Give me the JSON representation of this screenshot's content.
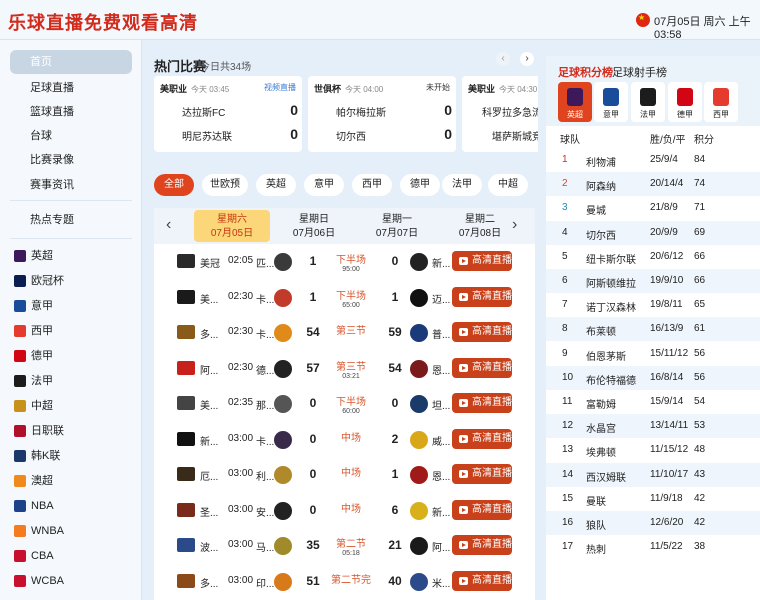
{
  "header": {
    "logo": "乐球直播免费观看高清",
    "datetime": "07月05日 周六 上午03:58"
  },
  "sidebar": {
    "items": [
      "首页",
      "足球直播",
      "篮球直播",
      "台球",
      "比赛录像",
      "赛事资讯",
      "热点专题"
    ],
    "leagues": [
      {
        "name": "英超",
        "color": "#3d195b"
      },
      {
        "name": "欧冠杯",
        "color": "#0b1d51"
      },
      {
        "name": "意甲",
        "color": "#1a4c9c"
      },
      {
        "name": "西甲",
        "color": "#e53b2f"
      },
      {
        "name": "德甲",
        "color": "#d20515"
      },
      {
        "name": "法甲",
        "color": "#1c1c1c"
      },
      {
        "name": "中超",
        "color": "#c8911c"
      },
      {
        "name": "日职联",
        "color": "#b0102a"
      },
      {
        "name": "韩K联",
        "color": "#1b3a6b"
      },
      {
        "name": "澳超",
        "color": "#f08a1c"
      },
      {
        "name": "NBA",
        "color": "#1d428a"
      },
      {
        "name": "WNBA",
        "color": "#f57b20"
      },
      {
        "name": "CBA",
        "color": "#c8102e"
      },
      {
        "name": "WCBA",
        "color": "#c8102e"
      }
    ]
  },
  "hot": {
    "title": "热门比赛",
    "subtitle": "今日共34场",
    "cards": [
      {
        "league": "美职业",
        "time": "今天 03:45",
        "status": "视频直播",
        "home": "达拉斯FC",
        "home_score": "0",
        "away": "明尼苏达联",
        "away_score": "0"
      },
      {
        "league": "世俱杯",
        "time": "今天 04:00",
        "status": "未开始",
        "home": "帕尔梅拉斯",
        "home_score": "0",
        "away": "切尔西",
        "away_score": "0"
      },
      {
        "league": "美职业",
        "time": "今天 04:30",
        "status": "",
        "home": "科罗拉多急流",
        "home_score": "",
        "away": "堪萨斯城竞技",
        "away_score": ""
      }
    ]
  },
  "filters": [
    "全部",
    "世欧预",
    "英超",
    "意甲",
    "西甲",
    "德甲",
    "法甲",
    "中超"
  ],
  "dates": [
    {
      "day": "星期六",
      "date": "07月05日"
    },
    {
      "day": "星期日",
      "date": "07月06日"
    },
    {
      "day": "星期一",
      "date": "07月07日"
    },
    {
      "day": "星期二",
      "date": "07月08日"
    }
  ],
  "watch_label": "高清直播",
  "matches": [
    {
      "name": "美冠",
      "time": "02:05",
      "home": "匹...",
      "hs": "1",
      "status": "下半场",
      "clock": "95:00",
      "as": "0",
      "away": "新...",
      "lg": "#2a2a2a",
      "hc": "#3a3a3a",
      "ac": "#222"
    },
    {
      "name": "美...",
      "time": "02:30",
      "home": "卡...",
      "hs": "1",
      "status": "下半场",
      "clock": "65:00",
      "as": "1",
      "away": "迈...",
      "lg": "#1a1a1a",
      "hc": "#c23a2a",
      "ac": "#111"
    },
    {
      "name": "多...",
      "time": "02:30",
      "home": "卡...",
      "hs": "54",
      "status": "第三节",
      "clock": "",
      "as": "59",
      "away": "普...",
      "lg": "#8a5a1a",
      "hc": "#e08a1a",
      "ac": "#1a3a7a"
    },
    {
      "name": "阿...",
      "time": "02:30",
      "home": "德...",
      "hs": "57",
      "status": "第三节",
      "clock": "03:21",
      "as": "54",
      "away": "恩...",
      "lg": "#c8201a",
      "hc": "#222",
      "ac": "#7a1a1a"
    },
    {
      "name": "美...",
      "time": "02:35",
      "home": "那...",
      "hs": "0",
      "status": "下半场",
      "clock": "60:00",
      "as": "0",
      "away": "坦...",
      "lg": "#444",
      "hc": "#555",
      "ac": "#1a3a6a"
    },
    {
      "name": "新...",
      "time": "03:00",
      "home": "卡...",
      "hs": "0",
      "status": "中场",
      "clock": "",
      "as": "2",
      "away": "威...",
      "lg": "#111",
      "hc": "#3a2a4a",
      "ac": "#d8a81a"
    },
    {
      "name": "厄...",
      "time": "03:00",
      "home": "利...",
      "hs": "0",
      "status": "中场",
      "clock": "",
      "as": "1",
      "away": "恩...",
      "lg": "#3a2a1a",
      "hc": "#b08a2a",
      "ac": "#a01a1a"
    },
    {
      "name": "圣...",
      "time": "03:00",
      "home": "安...",
      "hs": "0",
      "status": "中场",
      "clock": "",
      "as": "6",
      "away": "新...",
      "lg": "#7a2a1a",
      "hc": "#222",
      "ac": "#d8b01a"
    },
    {
      "name": "波...",
      "time": "03:00",
      "home": "马...",
      "hs": "35",
      "status": "第二节",
      "clock": "05:18",
      "as": "21",
      "away": "阿...",
      "lg": "#2a4a8a",
      "hc": "#a08a2a",
      "ac": "#1a1a1a"
    },
    {
      "name": "多...",
      "time": "03:00",
      "home": "印...",
      "hs": "51",
      "status": "第二节完",
      "clock": "",
      "as": "40",
      "away": "米...",
      "lg": "#8a4a1a",
      "hc": "#d87a1a",
      "ac": "#2a4a8a"
    }
  ],
  "standings": {
    "tab_active": "足球积分榜",
    "tab_other": "足球射手榜",
    "leagues": [
      {
        "name": "英超",
        "color": "#3d195b"
      },
      {
        "name": "意甲",
        "color": "#1a4c9c"
      },
      {
        "name": "法甲",
        "color": "#1c1c1c"
      },
      {
        "name": "德甲",
        "color": "#d20515"
      },
      {
        "name": "西甲",
        "color": "#e53b2f"
      }
    ],
    "headers": {
      "team": "球队",
      "wdl": "胜/负/平",
      "pts": "积分"
    },
    "rows": [
      {
        "rank": "1",
        "team": "利物浦",
        "wdl": "25/9/4",
        "pts": "84"
      },
      {
        "rank": "2",
        "team": "阿森纳",
        "wdl": "20/14/4",
        "pts": "74"
      },
      {
        "rank": "3",
        "team": "曼城",
        "wdl": "21/8/9",
        "pts": "71"
      },
      {
        "rank": "4",
        "team": "切尔西",
        "wdl": "20/9/9",
        "pts": "69"
      },
      {
        "rank": "5",
        "team": "纽卡斯尔联",
        "wdl": "20/6/12",
        "pts": "66"
      },
      {
        "rank": "6",
        "team": "阿斯顿维拉",
        "wdl": "19/9/10",
        "pts": "66"
      },
      {
        "rank": "7",
        "team": "诺丁汉森林",
        "wdl": "19/8/11",
        "pts": "65"
      },
      {
        "rank": "8",
        "team": "布莱顿",
        "wdl": "16/13/9",
        "pts": "61"
      },
      {
        "rank": "9",
        "team": "伯恩茅斯",
        "wdl": "15/11/12",
        "pts": "56"
      },
      {
        "rank": "10",
        "team": "布伦特福德",
        "wdl": "16/8/14",
        "pts": "56"
      },
      {
        "rank": "11",
        "team": "富勒姆",
        "wdl": "15/9/14",
        "pts": "54"
      },
      {
        "rank": "12",
        "team": "水晶宫",
        "wdl": "13/14/11",
        "pts": "53"
      },
      {
        "rank": "13",
        "team": "埃弗顿",
        "wdl": "11/15/12",
        "pts": "48"
      },
      {
        "rank": "14",
        "team": "西汉姆联",
        "wdl": "11/10/17",
        "pts": "43"
      },
      {
        "rank": "15",
        "team": "曼联",
        "wdl": "11/9/18",
        "pts": "42"
      },
      {
        "rank": "16",
        "team": "狼队",
        "wdl": "12/6/20",
        "pts": "42"
      },
      {
        "rank": "17",
        "team": "热刺",
        "wdl": "11/5/22",
        "pts": "38"
      }
    ]
  }
}
